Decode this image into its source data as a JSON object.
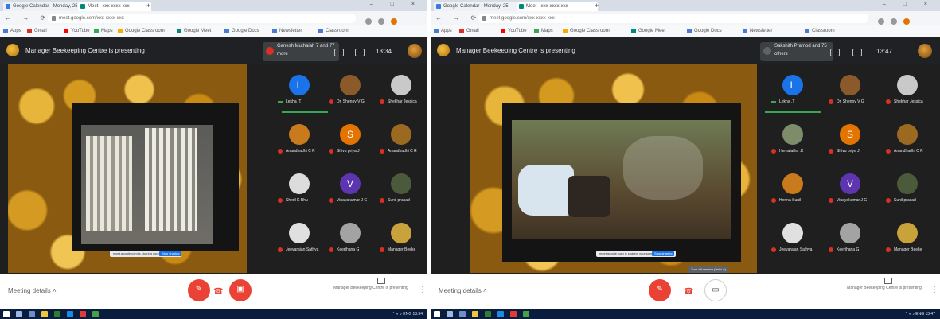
{
  "left": {
    "tabs": [
      "Google Calendar - Monday, 25",
      "Meet - xxx-xxxx-xxx"
    ],
    "url": "meet.google.com/xxx-xxxx-xxx",
    "bookmarks": [
      "Apps",
      "Gmail",
      "YouTube",
      "Maps",
      "Google Classroom",
      "Google Meet",
      "Google Docs",
      "Newsletter",
      "Classroom"
    ],
    "presenting_text": "Manager Beekeeping Centre is presenting",
    "self_tile": "Ganesh Muthaiah 7 and 77 more",
    "clock": "13:34",
    "participants": [
      {
        "name": "Lekha .T",
        "initial": "L",
        "color": "#1a73e8",
        "pinned": true
      },
      {
        "name": "Dr. Shenoy V G",
        "initial": "",
        "color": "#8b5a2b"
      },
      {
        "name": "Shekhar Jessica",
        "initial": "",
        "color": "#c9c9c9"
      },
      {
        "name": "Anandhadhi C R",
        "initial": "",
        "color": "#c97a1c"
      },
      {
        "name": "Shivu priya J",
        "initial": "S",
        "color": "#e37400"
      },
      {
        "name": "Anandhadhi C R",
        "initial": "",
        "color": "#9b6a20"
      },
      {
        "name": "Sheril K Bhu",
        "initial": "",
        "color": "#dcdcdc"
      },
      {
        "name": "Vinayakumar J G",
        "initial": "V",
        "color": "#5e35b1"
      },
      {
        "name": "Sunil prasad",
        "initial": "",
        "color": "#4a5a3a"
      },
      {
        "name": "Jeevarajan Sathya",
        "initial": "",
        "color": "#e0e0e0"
      },
      {
        "name": "Keerthana G",
        "initial": "",
        "color": "#a3a3a3"
      },
      {
        "name": "Manager Beeke",
        "initial": "",
        "color": "#caa23c"
      }
    ],
    "meeting_details": "Meeting details",
    "presenting_caption": "Manager Beekeeping Centre is presenting",
    "share_pill": "meet.google.com is sharing your screen",
    "share_btn": "Stop sharing",
    "tooltip": ""
  },
  "right": {
    "tabs": [
      "Google Calendar - Monday, 25",
      "Meet - xxx-xxxx-xxx"
    ],
    "url": "meet.google.com/xxx-xxxx-xxx",
    "bookmarks": [
      "Apps",
      "Gmail",
      "YouTube",
      "Maps",
      "Google Classroom",
      "Google Meet",
      "Google Docs",
      "Newsletter",
      "Classroom"
    ],
    "presenting_text": "Manager Beekeeping Centre is presenting",
    "self_tile": "Sakshith Pramod and 75 others",
    "clock": "13:47",
    "participants": [
      {
        "name": "Lekha .T",
        "initial": "L",
        "color": "#1a73e8",
        "pinned": true
      },
      {
        "name": "Dr. Shenoy V G",
        "initial": "",
        "color": "#8b5a2b"
      },
      {
        "name": "Shekhar Jessica",
        "initial": "",
        "color": "#c9c9c9"
      },
      {
        "name": "Hemalatha .K",
        "initial": "",
        "color": "#7d8d6a"
      },
      {
        "name": "Shivu priya J",
        "initial": "S",
        "color": "#e37400"
      },
      {
        "name": "Anandhadhi C R",
        "initial": "",
        "color": "#9b6a20"
      },
      {
        "name": "Henna Sunil",
        "initial": "",
        "color": "#c97a1c"
      },
      {
        "name": "Vinayakumar J G",
        "initial": "V",
        "color": "#5e35b1"
      },
      {
        "name": "Sunil prasad",
        "initial": "",
        "color": "#4a5a3a"
      },
      {
        "name": "Jeevarajan Sathya",
        "initial": "",
        "color": "#e0e0e0"
      },
      {
        "name": "Keerthana G",
        "initial": "",
        "color": "#a3a3a3"
      },
      {
        "name": "Manager Beeke",
        "initial": "",
        "color": "#caa23c"
      }
    ],
    "meeting_details": "Meeting details",
    "presenting_caption": "Manager Beekeeping Centre is presenting",
    "share_pill": "meet.google.com is sharing your screen",
    "share_btn": "Stop sharing",
    "tooltip": "Turn off camera (ctrl + e)"
  },
  "accent": "#ea4335",
  "icons": {
    "hangup": "phone-hangup-icon",
    "camera": "camera-icon",
    "mic": "mic-off-icon"
  }
}
